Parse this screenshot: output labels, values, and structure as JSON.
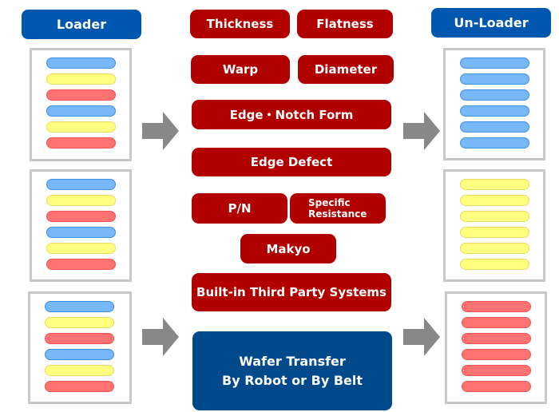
{
  "loader_label": "Loader",
  "unloader_label": "Un-Loader",
  "inspections": {
    "thickness": "Thickness",
    "flatness": "Flatness",
    "warp": "Warp",
    "diameter": "Diameter",
    "edge_notch": "Edge・Notch Form",
    "edge_defect": "Edge Defect",
    "pn": "P/N",
    "specific_resistance": [
      "Specific",
      "Resistance"
    ],
    "makyo": "Makyo",
    "third_party": "Built-in Third Party Systems"
  },
  "transfer": [
    "Wafer Transfer",
    "By Robot or By Belt"
  ],
  "colors": {
    "blue": "#78b8f8",
    "yellow": "#ffff80",
    "red": "#ff7272",
    "box_red": "#b10000",
    "header_blue": "#0057b0",
    "transfer_blue": "#004a8c",
    "arrow": "#888888"
  },
  "loader_cassettes": [
    [
      "blue",
      "yellow",
      "red",
      "blue",
      "yellow",
      "red"
    ],
    [
      "blue",
      "yellow",
      "red",
      "blue",
      "yellow",
      "red"
    ],
    [
      "blue",
      "yellow",
      "red",
      "blue",
      "yellow",
      "red"
    ]
  ],
  "unloader_cassettes": [
    [
      "blue",
      "blue",
      "blue",
      "blue",
      "blue",
      "blue"
    ],
    [
      "yellow",
      "yellow",
      "yellow",
      "yellow",
      "yellow",
      "yellow"
    ],
    [
      "red",
      "red",
      "red",
      "red",
      "red",
      "red"
    ]
  ]
}
